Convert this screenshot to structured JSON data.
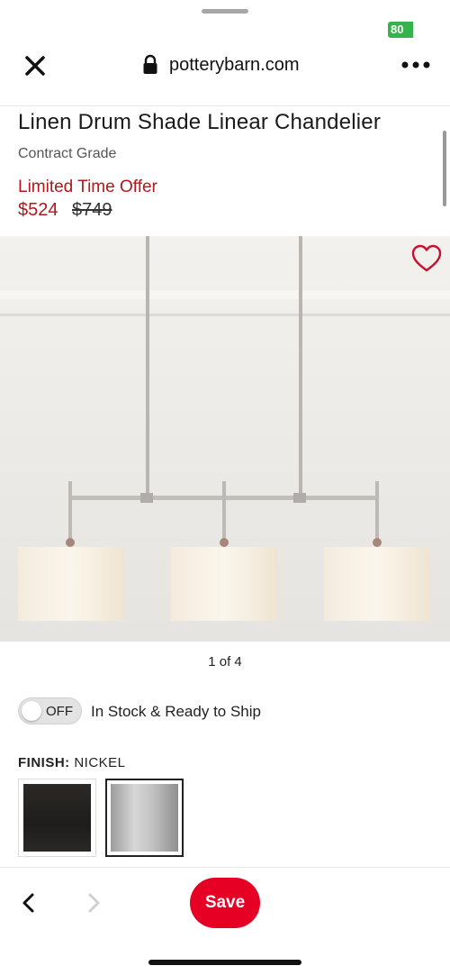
{
  "status_bar": {
    "battery": "80"
  },
  "browser": {
    "url": "potterybarn.com",
    "icons": {
      "close": "close-icon",
      "lock": "lock-icon",
      "more": "more-icon"
    }
  },
  "product": {
    "title": "Linen Drum Shade Linear Chandelier",
    "subtitle": "Contract Grade",
    "offer_label": "Limited Time Offer",
    "price": "$524",
    "original_price": "$749",
    "image_pager": "1 of 4"
  },
  "availability": {
    "toggle_state": "OFF",
    "label": "In Stock & Ready to Ship"
  },
  "finish": {
    "label": "FINISH:",
    "selected": "NICKEL",
    "swatches": [
      {
        "name": "bronze",
        "selected": false
      },
      {
        "name": "nickel",
        "selected": true
      }
    ]
  },
  "toolbar": {
    "save_label": "Save",
    "save_color": "#e60023"
  },
  "colors": {
    "sale_red": "#b4161b",
    "heart_red": "#c8102e"
  }
}
